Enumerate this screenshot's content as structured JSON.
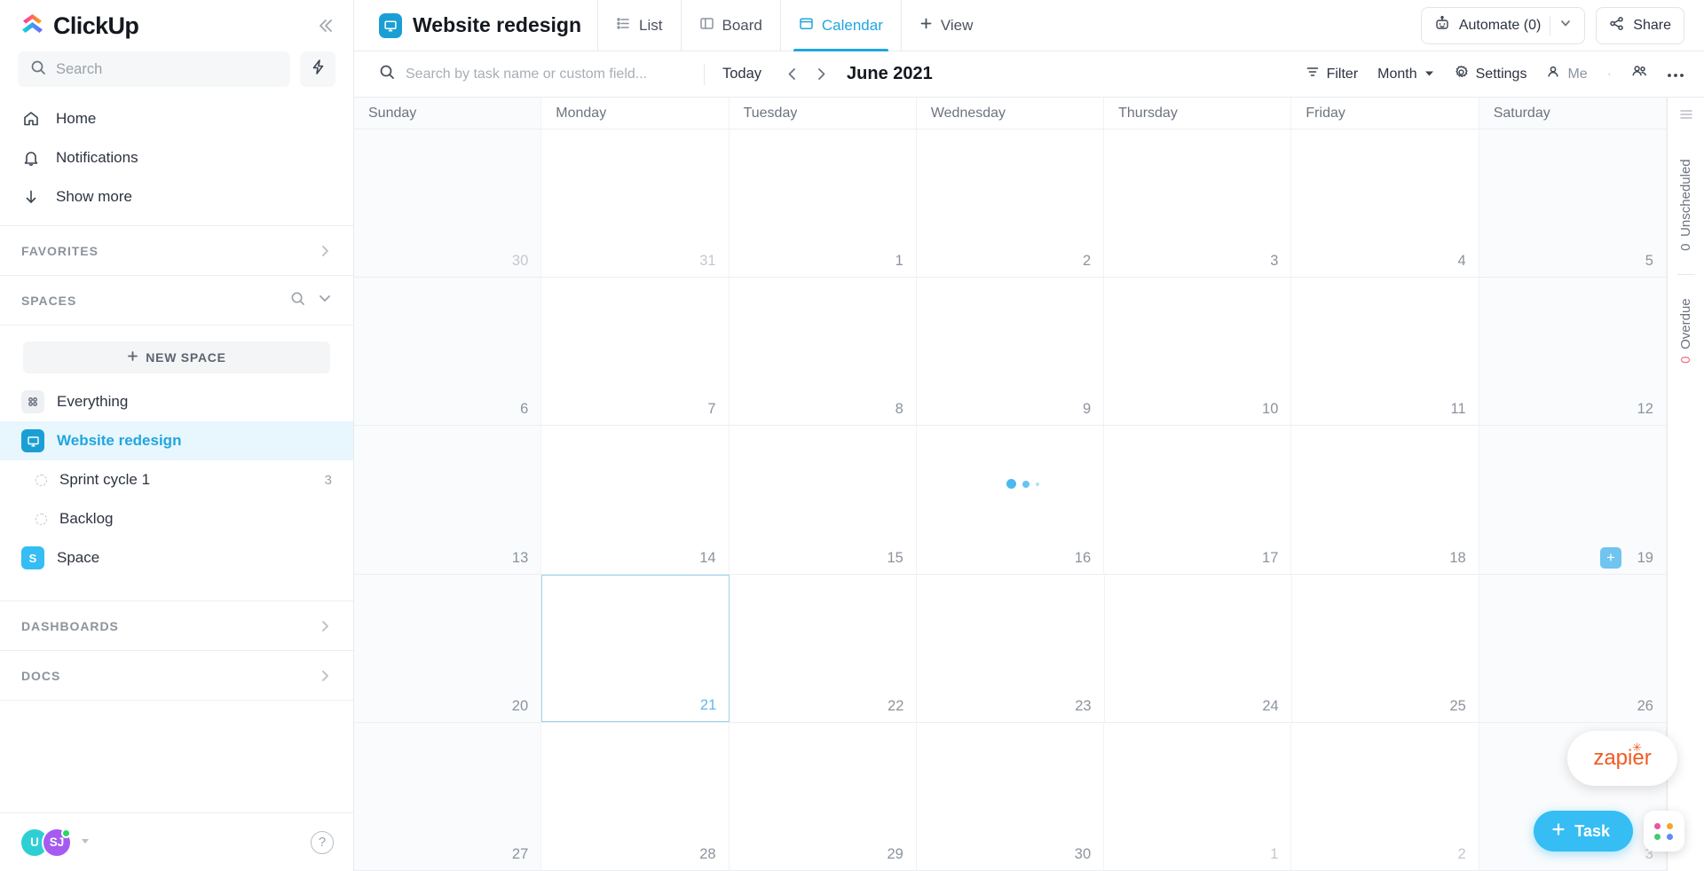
{
  "brand": {
    "name": "ClickUp",
    "accent": "#20a6e0",
    "blue": "#35bdf4"
  },
  "sidebar": {
    "search": {
      "placeholder": "Search",
      "value": ""
    },
    "nav": [
      {
        "label": "Home",
        "icon": "home-icon"
      },
      {
        "label": "Notifications",
        "icon": "bell-icon"
      },
      {
        "label": "Show more",
        "icon": "arrow-down-icon"
      }
    ],
    "favorites": {
      "label": "FAVORITES"
    },
    "spaces": {
      "label": "SPACES",
      "new_space": "NEW SPACE"
    },
    "space_items": [
      {
        "label": "Everything",
        "icon": "grid-icon",
        "active": false
      },
      {
        "label": "Website redesign",
        "icon": "monitor-icon",
        "active": true
      }
    ],
    "lists": [
      {
        "label": "Sprint cycle 1",
        "count": "3"
      },
      {
        "label": "Backlog",
        "count": ""
      }
    ],
    "other_space": {
      "label": "Space",
      "initial": "S",
      "color": "#35bdf4"
    },
    "dashboards": {
      "label": "DASHBOARDS"
    },
    "docs": {
      "label": "DOCS"
    },
    "footer": {
      "avatars": [
        {
          "initials": "U",
          "color": "#2ecfd4"
        },
        {
          "initials": "SJ",
          "color": "#a55bf0"
        }
      ],
      "help_label": "?"
    }
  },
  "header": {
    "title": "Website redesign",
    "tabs": [
      {
        "label": "List",
        "icon": "list-icon",
        "active": false
      },
      {
        "label": "Board",
        "icon": "board-icon",
        "active": false
      },
      {
        "label": "Calendar",
        "icon": "calendar-icon",
        "active": true
      }
    ],
    "add_view": "View",
    "automate": "Automate (0)",
    "share": "Share"
  },
  "toolbar": {
    "search_placeholder": "Search by task name or custom field...",
    "search_value": "",
    "today": "Today",
    "period": "June 2021",
    "filter": "Filter",
    "zoom": "Month",
    "settings": "Settings",
    "me": "Me"
  },
  "calendar": {
    "weekdays": [
      "Sunday",
      "Monday",
      "Tuesday",
      "Wednesday",
      "Thursday",
      "Friday",
      "Saturday"
    ],
    "weeks": [
      [
        {
          "day": "30",
          "muted": true
        },
        {
          "day": "31",
          "muted": true
        },
        {
          "day": "1"
        },
        {
          "day": "2"
        },
        {
          "day": "3"
        },
        {
          "day": "4"
        },
        {
          "day": "5"
        }
      ],
      [
        {
          "day": "6"
        },
        {
          "day": "7"
        },
        {
          "day": "8"
        },
        {
          "day": "9"
        },
        {
          "day": "10"
        },
        {
          "day": "11"
        },
        {
          "day": "12"
        }
      ],
      [
        {
          "day": "13"
        },
        {
          "day": "14"
        },
        {
          "day": "15"
        },
        {
          "day": "16",
          "loading": true
        },
        {
          "day": "17"
        },
        {
          "day": "18"
        },
        {
          "day": "19",
          "add_button": true
        }
      ],
      [
        {
          "day": "20"
        },
        {
          "day": "21",
          "today": true,
          "selected": true
        },
        {
          "day": "22"
        },
        {
          "day": "23"
        },
        {
          "day": "24"
        },
        {
          "day": "25"
        },
        {
          "day": "26"
        }
      ],
      [
        {
          "day": "27"
        },
        {
          "day": "28"
        },
        {
          "day": "29"
        },
        {
          "day": "30"
        },
        {
          "day": "1",
          "muted": true
        },
        {
          "day": "2",
          "muted": true
        },
        {
          "day": "3",
          "muted": true
        }
      ]
    ]
  },
  "rail": {
    "unscheduled": {
      "count": "0",
      "label": "Unscheduled"
    },
    "overdue": {
      "count": "0",
      "label": "Overdue"
    }
  },
  "floating": {
    "zapier": "zapier",
    "task_button": "Task"
  }
}
